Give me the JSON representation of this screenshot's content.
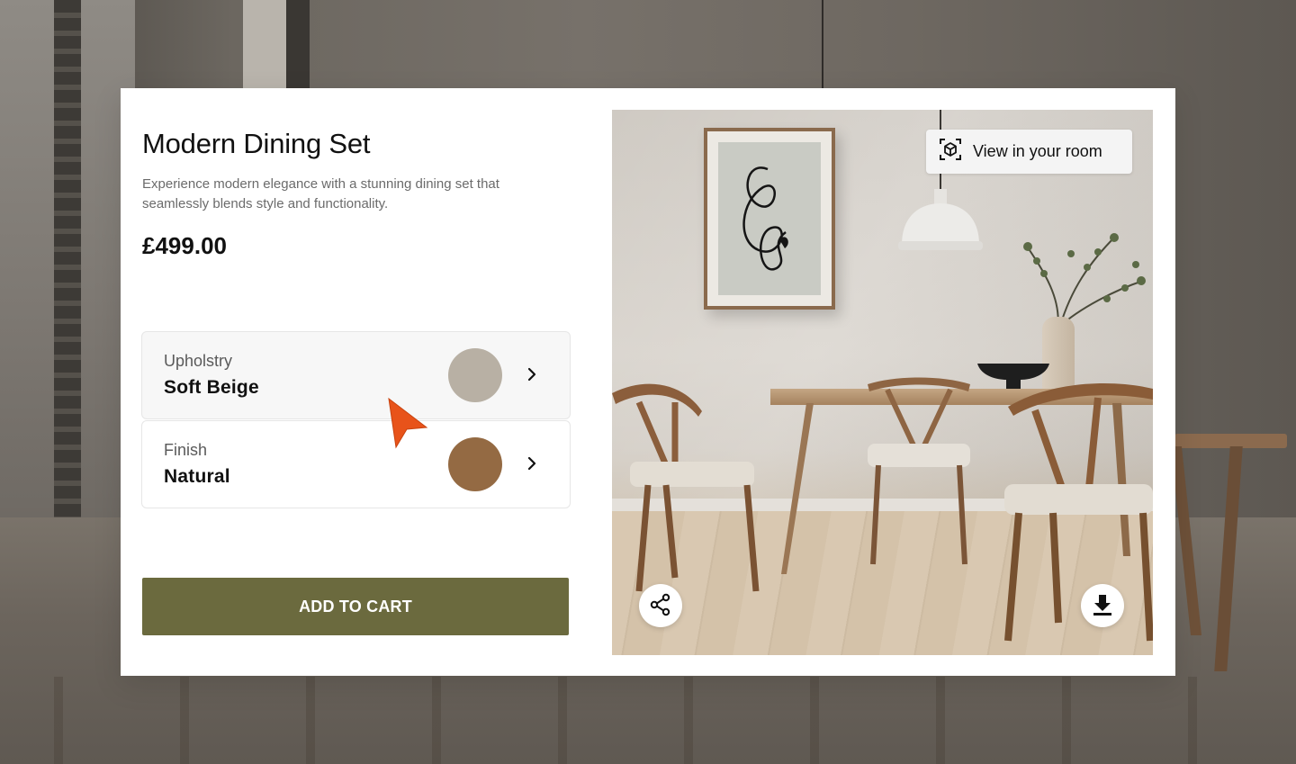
{
  "product": {
    "title": "Modern Dining Set",
    "description": "Experience modern elegance with a stunning dining set that seamlessly blends style and functionality.",
    "price": "£499.00"
  },
  "options": [
    {
      "label": "Upholstry",
      "value": "Soft Beige",
      "swatch_color": "#b8b0a4",
      "icon": "chevron-right-icon"
    },
    {
      "label": "Finish",
      "value": "Natural",
      "swatch_color": "#946a43",
      "icon": "chevron-right-icon"
    }
  ],
  "cart": {
    "add_label": "ADD TO CART",
    "button_color": "#6b6a3e"
  },
  "image_panel": {
    "view_room_label": "View in your room",
    "view_room_icon": "ar-cube-icon",
    "share_icon": "share-icon",
    "download_icon": "download-icon"
  },
  "colors": {
    "cursor": "#e8531a",
    "card_background": "#ffffff"
  }
}
